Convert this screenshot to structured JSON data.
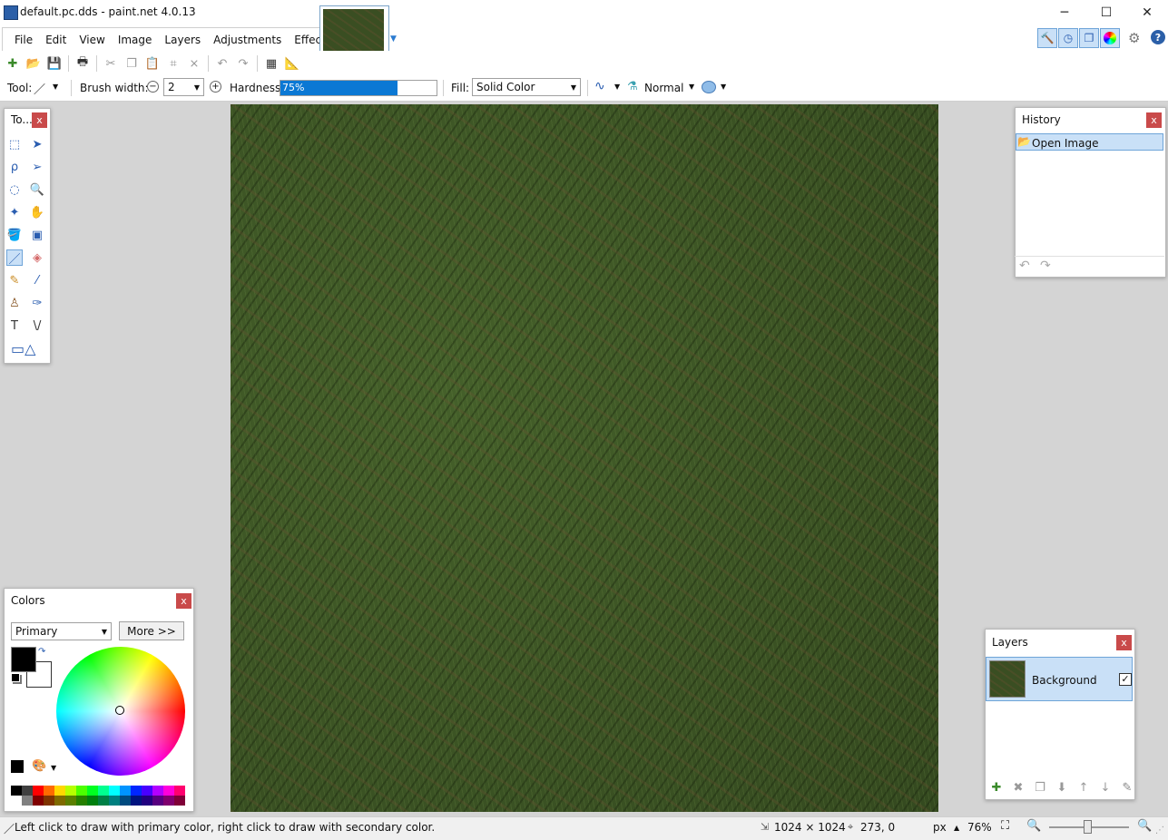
{
  "window": {
    "title": "default.pc.dds - paint.net 4.0.13",
    "minimize_glyph": "─",
    "maximize_glyph": "☐",
    "close_glyph": "✕"
  },
  "menu": [
    "File",
    "Edit",
    "View",
    "Image",
    "Layers",
    "Adjustments",
    "Effects"
  ],
  "toolbar2": {
    "tool_label": "Tool:",
    "brush_width_label": "Brush width:",
    "brush_width_value": "2",
    "hardness_label": "Hardness:",
    "hardness_value": "75%",
    "hardness_fraction": 0.75,
    "fill_label": "Fill:",
    "fill_value": "Solid Color",
    "blend_mode": "Normal"
  },
  "tools_panel": {
    "title": "To...",
    "close": "x"
  },
  "history_panel": {
    "title": "History",
    "close": "x",
    "items": [
      "Open Image"
    ]
  },
  "colors_panel": {
    "title": "Colors",
    "close": "x",
    "mode_value": "Primary",
    "more_button": "More >>",
    "primary_color": "#000000",
    "secondary_color": "#ffffff"
  },
  "layers_panel": {
    "title": "Layers",
    "close": "x",
    "layers": [
      {
        "name": "Background",
        "visible": true
      }
    ]
  },
  "statusbar": {
    "hint": "Left click to draw with primary color, right click to draw with secondary color.",
    "image_size": "1024 × 1024",
    "cursor_position": "273, 0",
    "units": "px",
    "zoom": "76%",
    "zoom_slider_fraction": 0.48
  },
  "colors": {
    "accent": "#0b78d4",
    "selection": "#c9e0f7",
    "close_red": "#c94a4a",
    "canvas_grass": "#3a4e22"
  }
}
